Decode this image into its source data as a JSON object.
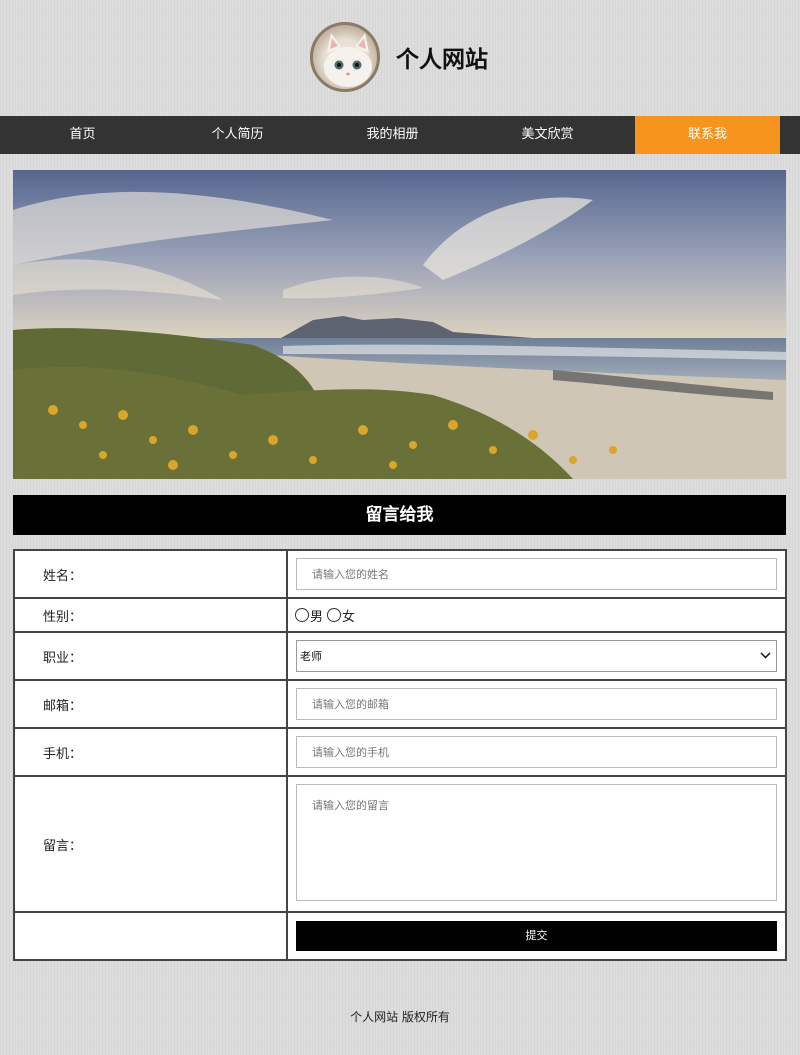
{
  "header": {
    "site_title": "个人网站"
  },
  "nav": {
    "items": [
      {
        "label": "首页"
      },
      {
        "label": "个人简历"
      },
      {
        "label": "我的相册"
      },
      {
        "label": "美文欣赏"
      },
      {
        "label": "联系我"
      }
    ],
    "active_index": 4,
    "active_color": "#f7941d",
    "bar_color": "#333333"
  },
  "section": {
    "title": "留言给我"
  },
  "form": {
    "name": {
      "label": "姓名：",
      "placeholder": "请输入您的姓名"
    },
    "gender": {
      "label": "性别：",
      "options": [
        "男",
        "女"
      ]
    },
    "job": {
      "label": "职业：",
      "selected": "老师"
    },
    "email": {
      "label": "邮箱：",
      "placeholder": "请输入您的邮箱"
    },
    "phone": {
      "label": "手机：",
      "placeholder": "请输入您的手机"
    },
    "message": {
      "label": "留言：",
      "placeholder": "请输入您的留言"
    },
    "submit_label": "提交"
  },
  "footer": {
    "text": "个人网站 版权所有"
  }
}
